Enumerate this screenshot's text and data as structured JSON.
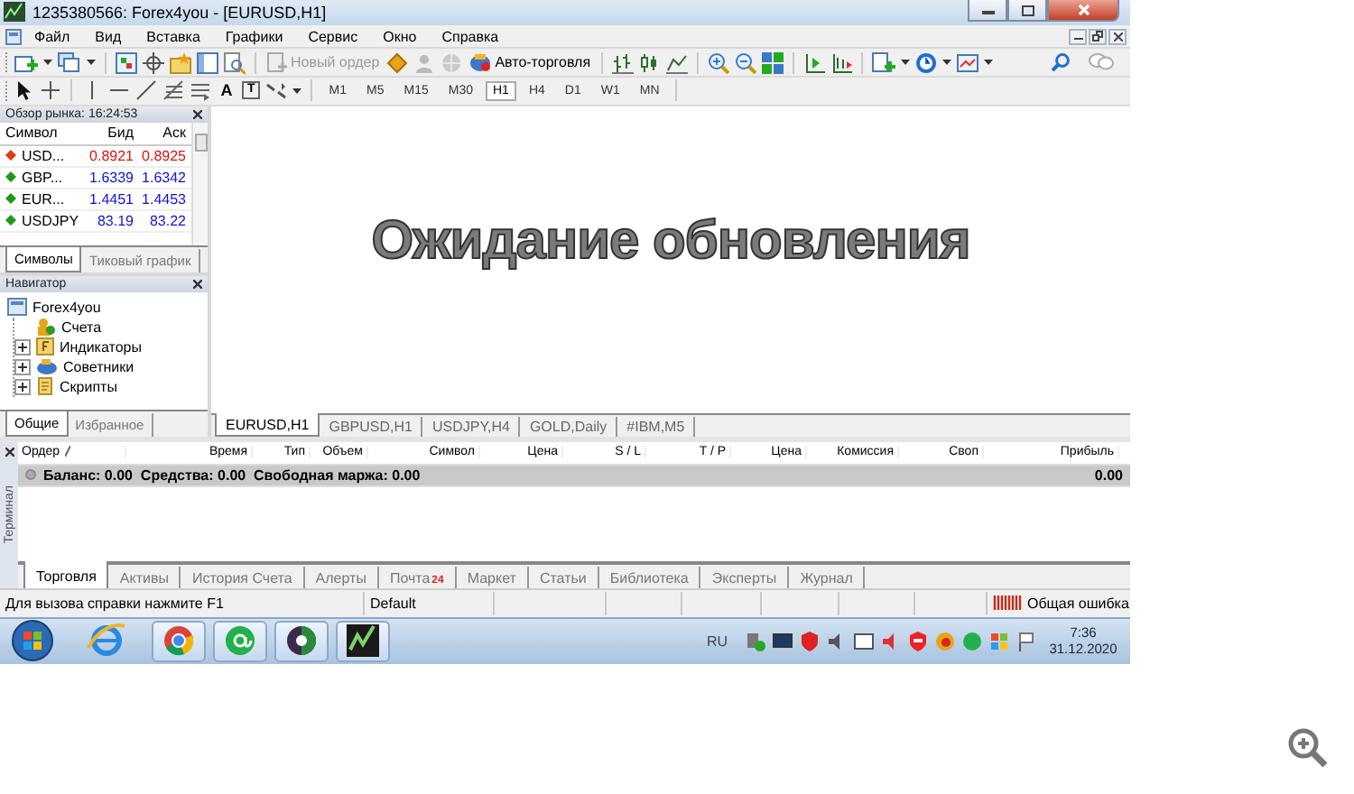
{
  "window": {
    "title": "1235380566: Forex4you - [EURUSD,H1]"
  },
  "menu": [
    "Файл",
    "Вид",
    "Вставка",
    "Графики",
    "Сервис",
    "Окно",
    "Справка"
  ],
  "toolbar": {
    "new_order": {
      "label": "Новый ордер",
      "disabled": true
    },
    "auto_trading": {
      "label": "Авто-торговля",
      "disabled": false
    }
  },
  "drawing_tools": {
    "text_glyph": "A",
    "label_glyph": "T"
  },
  "timeframes": [
    {
      "label": "M1",
      "selected": false
    },
    {
      "label": "M5",
      "selected": false
    },
    {
      "label": "M15",
      "selected": false
    },
    {
      "label": "M30",
      "selected": false
    },
    {
      "label": "H1",
      "selected": true
    },
    {
      "label": "H4",
      "selected": false
    },
    {
      "label": "D1",
      "selected": false
    },
    {
      "label": "W1",
      "selected": false
    },
    {
      "label": "MN",
      "selected": false
    }
  ],
  "market_watch": {
    "title": "Обзор рынка: 16:24:53",
    "columns": [
      "Символ",
      "Бид",
      "Аск"
    ],
    "rows": [
      {
        "symbol": "USD...",
        "bid": "0.8921",
        "ask": "0.8925",
        "falling": true
      },
      {
        "symbol": "GBP...",
        "bid": "1.6339",
        "ask": "1.6342",
        "falling": false
      },
      {
        "symbol": "EUR...",
        "bid": "1.4451",
        "ask": "1.4453",
        "falling": false
      },
      {
        "symbol": "USDJPY",
        "bid": "83.19",
        "ask": "83.22",
        "falling": false
      }
    ],
    "tabs": [
      {
        "label": "Символы",
        "selected": true
      },
      {
        "label": "Тиковый график",
        "selected": false
      }
    ]
  },
  "navigator": {
    "title": "Навигатор",
    "tree": [
      {
        "label": "Forex4you",
        "children": [
          {
            "label": "Счета",
            "kind": "leaf"
          },
          {
            "label": "Индикаторы",
            "kind": "collapsed"
          },
          {
            "label": "Советники",
            "kind": "collapsed"
          },
          {
            "label": "Скрипты",
            "kind": "collapsed"
          }
        ]
      }
    ],
    "tabs": [
      {
        "label": "Общие",
        "selected": true
      },
      {
        "label": "Избранное",
        "selected": false
      }
    ]
  },
  "chart": {
    "message": "Ожидание обновления",
    "tabs": [
      {
        "label": "EURUSD,H1",
        "selected": true
      },
      {
        "label": "GBPUSD,H1",
        "selected": false
      },
      {
        "label": "USDJPY,H4",
        "selected": false
      },
      {
        "label": "GOLD,Daily",
        "selected": false
      },
      {
        "label": "#IBM,M5",
        "selected": false
      }
    ]
  },
  "terminal": {
    "side_label": "Терминал",
    "columns": [
      {
        "label": "Ордер",
        "sorted": true
      },
      {
        "label": "Время",
        "sorted": false
      },
      {
        "label": "Тип",
        "sorted": false
      },
      {
        "label": "Объем",
        "sorted": false
      },
      {
        "label": "Символ",
        "sorted": false
      },
      {
        "label": "Цена",
        "sorted": false
      },
      {
        "label": "S / L",
        "sorted": false
      },
      {
        "label": "T / P",
        "sorted": false
      },
      {
        "label": "Цена",
        "sorted": false
      },
      {
        "label": "Комиссия",
        "sorted": false
      },
      {
        "label": "Своп",
        "sorted": false
      },
      {
        "label": "Прибыль",
        "sorted": false
      }
    ],
    "summary": "Баланс: 0.00  Средства: 0.00  Свободная маржа: 0.00",
    "summary_profit": "0.00",
    "tabs": [
      {
        "label": "Торговля",
        "selected": true
      },
      {
        "label": "Активы",
        "selected": false
      },
      {
        "label": "История Счета",
        "selected": false
      },
      {
        "label": "Алерты",
        "selected": false
      },
      {
        "label": "Почта",
        "selected": false,
        "badge": "24"
      },
      {
        "label": "Маркет",
        "selected": false
      },
      {
        "label": "Статьи",
        "selected": false
      },
      {
        "label": "Библиотека",
        "selected": false
      },
      {
        "label": "Эксперты",
        "selected": false
      },
      {
        "label": "Журнал",
        "selected": false
      }
    ]
  },
  "status_bar": {
    "help": "Для вызова справки нажмите F1",
    "profile": "Default",
    "connection": "Общая ошибка"
  },
  "taskbar": {
    "language": "RU",
    "time": "7:36",
    "date": "31.12.2020"
  }
}
